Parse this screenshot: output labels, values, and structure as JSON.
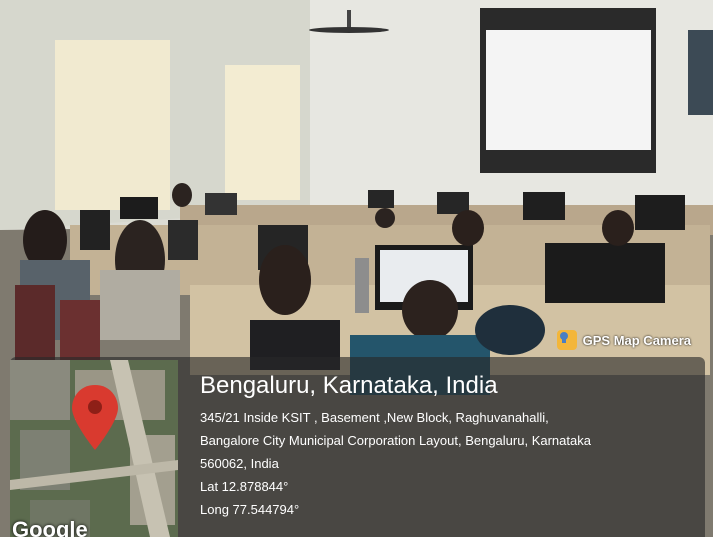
{
  "badge": {
    "label": "GPS Map Camera",
    "icon": "camera-pin-icon"
  },
  "location": {
    "title": "Bengaluru, Karnataka, India",
    "address_lines": [
      "345/21 Inside KSIT , Basement ,New Block, Raghuvanahalli,",
      "Bangalore City Municipal Corporation Layout, Bengaluru, Karnataka",
      "560062, India"
    ],
    "lat": "Lat 12.878844°",
    "long": "Long 77.544794°"
  },
  "map": {
    "watermark": "Google",
    "pin_icon": "map-pin-icon",
    "pin_color": "#d93a2f"
  }
}
